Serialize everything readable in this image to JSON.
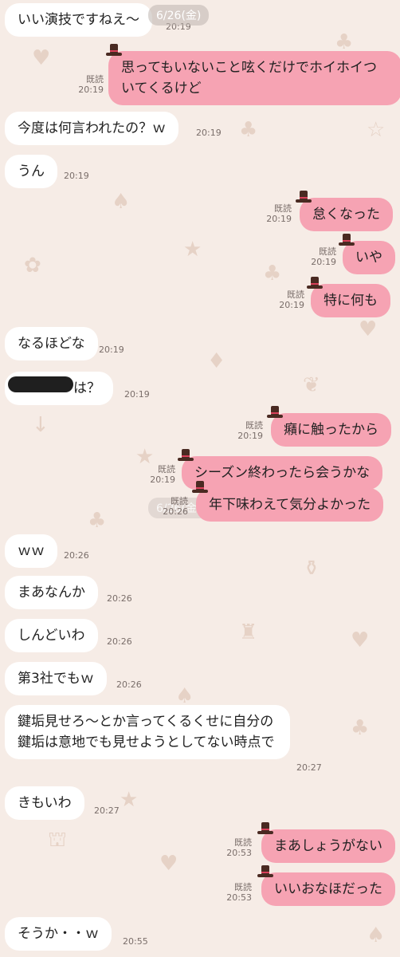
{
  "date_label": "6/26(金)",
  "read_label": "既読",
  "icons": {
    "sender_hat": "top-hat-icon",
    "wallpaper": "alice-wonderland-pattern"
  },
  "colors": {
    "background": "#f6ece6",
    "incoming_bubble": "#ffffff",
    "outgoing_bubble": "#f6a3b3"
  },
  "messages": [
    {
      "side": "in",
      "text": "いい演技ですねえ〜",
      "time": "20:19"
    },
    {
      "side": "out",
      "text": "思ってもいないこと呟くだけでホイホイついてくるけど",
      "time": "20:19",
      "read": "既読"
    },
    {
      "side": "in",
      "text": "今度は何言われたの？ｗ",
      "time": "20:19"
    },
    {
      "side": "in",
      "text": "うん",
      "time": "20:19"
    },
    {
      "side": "out",
      "text": "怠くなった",
      "time": "20:19",
      "read": "既読"
    },
    {
      "side": "out",
      "text": "いや",
      "time": "20:19",
      "read": "既読"
    },
    {
      "side": "out",
      "text": "特に何も",
      "time": "20:19",
      "read": "既読"
    },
    {
      "side": "in",
      "text": "なるほどな",
      "time": "20:19"
    },
    {
      "side": "in",
      "text": "は？",
      "time": "20:19"
    },
    {
      "side": "out",
      "text": "癪に触ったから",
      "time": "20:19",
      "read": "既読"
    },
    {
      "side": "out",
      "text": "シーズン終わったら会うかな",
      "time": "20:19",
      "read": "既読"
    },
    {
      "side": "out",
      "text": "年下味わえて気分よかった",
      "time": "20:26",
      "read": "既読"
    },
    {
      "side": "in",
      "text": "ｗｗ",
      "time": "20:26"
    },
    {
      "side": "in",
      "text": "まあなんか",
      "time": "20:26"
    },
    {
      "side": "in",
      "text": "しんどいわ",
      "time": "20:26"
    },
    {
      "side": "in",
      "text": "第3社でもｗ",
      "time": "20:26"
    },
    {
      "side": "in",
      "text": "鍵垢見せろ〜とか言ってくるくせに自分の鍵垢は意地でも見せようとしてない時点で",
      "time": "20:27"
    },
    {
      "side": "in",
      "text": "きもいわ",
      "time": "20:27"
    },
    {
      "side": "out",
      "text": "まあしょうがない",
      "time": "20:53",
      "read": "既読"
    },
    {
      "side": "out",
      "text": "いいおなほだった",
      "time": "20:53",
      "read": "既読"
    },
    {
      "side": "in",
      "text": "そうか・・ｗ",
      "time": "20:55"
    }
  ]
}
